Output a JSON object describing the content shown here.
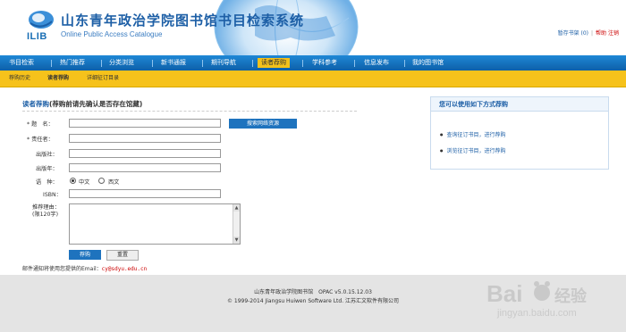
{
  "header": {
    "logo_text": "ILIB",
    "title": "山东青年政治学院图书馆书目检索系统",
    "subtitle": "Online Public Access Catalogue",
    "links": {
      "bookshelf": "暂存书架 (0)",
      "help": "帮助",
      "logout": "注销"
    }
  },
  "nav": {
    "items": [
      {
        "label": "书目检索"
      },
      {
        "label": "热门推荐"
      },
      {
        "label": "分类浏览"
      },
      {
        "label": "新书通报"
      },
      {
        "label": "期刊导航"
      },
      {
        "label": "读者荐购"
      },
      {
        "label": "学科参考"
      },
      {
        "label": "信息发布"
      },
      {
        "label": "我的图书馆"
      }
    ],
    "active": "读者荐购"
  },
  "subnav": {
    "items": [
      {
        "label": "荐购历史"
      },
      {
        "label": "读者荐购"
      },
      {
        "label": "详细征订目录"
      }
    ]
  },
  "form": {
    "title": "读者荐购",
    "note": "(荐购前请先确认是否存在馆藏)",
    "fields": {
      "title_label": "题　名：",
      "author_label": "责任者：",
      "publisher_label": "出版社：",
      "year_label": "出版年：",
      "lang_label": "语　种：",
      "isbn_label": "ISBN：",
      "reason_label": "推荐理由：",
      "reason_limit": "(限120字)"
    },
    "title_value": "",
    "author_value": "",
    "publisher_value": "",
    "year_value": "",
    "isbn_value": "",
    "reason_value": "",
    "search_network_btn": "搜索网络资源",
    "languages": {
      "chinese": "中文",
      "western": "西文",
      "selected": "中文"
    },
    "submit_btn": "荐购",
    "reset_btn": "重置",
    "required_marker": "*",
    "email_note": "邮件通知将使用您提供的Email：",
    "email": "cy@sdyu.edu.cn"
  },
  "side": {
    "title": "您可以使用如下方式荐购",
    "links": [
      {
        "label": "查询征订书目，进行荐购"
      },
      {
        "label": "浏览征订书目，进行荐购"
      }
    ]
  },
  "footer": {
    "line1": "山东青年政治学院图书馆　OPAC v5.0.15.12.03",
    "line2": "© 1999-2014 Jiangsu Huiwen Software Ltd. 江苏汇文软件有限公司"
  },
  "watermark": {
    "brand": "Bai",
    "brand2": "经验",
    "url": "jingyan.baidu.com"
  },
  "colors": {
    "nav_blue": "#1477c9",
    "accent_yellow": "#f6c21b",
    "title_blue": "#1d5fa6",
    "email_red": "#cc0000"
  }
}
